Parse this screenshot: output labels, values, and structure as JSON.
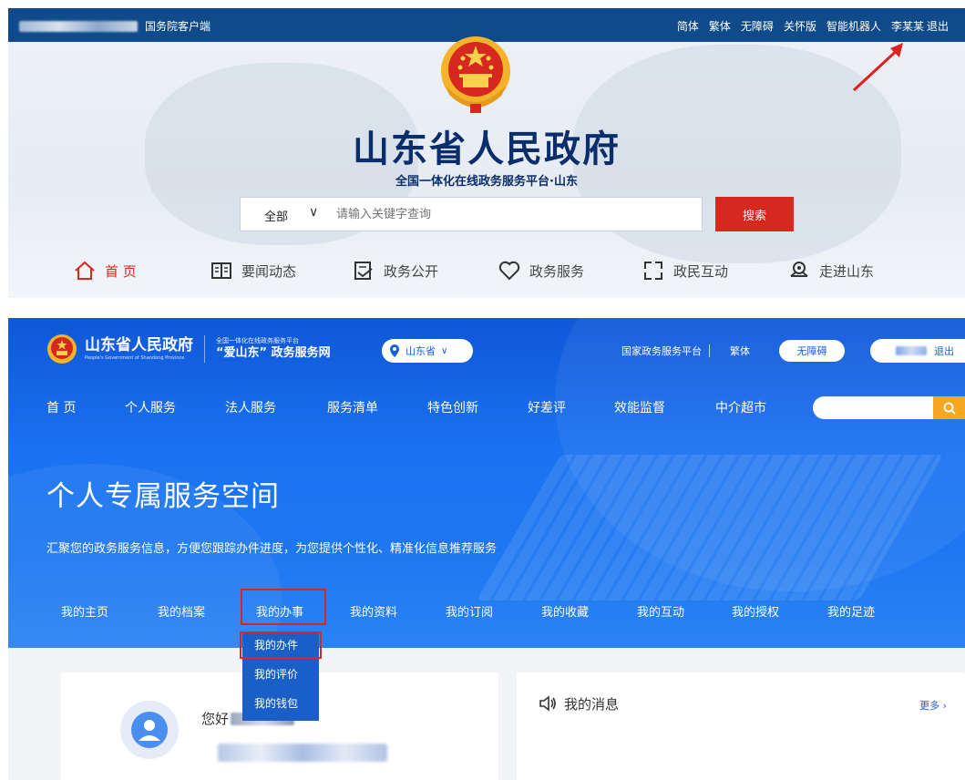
{
  "top": {
    "portal_name": "国务院客户端",
    "links": [
      "简体",
      "繁体",
      "无障碍",
      "关怀版",
      "智能机器人",
      "李某某",
      "退出"
    ],
    "title": "山东省人民政府",
    "subtitle": "全国一体化在线政务服务平台·山东",
    "search": {
      "scope": "全部",
      "placeholder": "请输入关键字查询",
      "button": "搜索"
    },
    "nav": [
      {
        "label": "首 页",
        "icon": "home-icon"
      },
      {
        "label": "要闻动态",
        "icon": "book-icon"
      },
      {
        "label": "政务公开",
        "icon": "inbox-icon"
      },
      {
        "label": "政务服务",
        "icon": "heart-icon"
      },
      {
        "label": "政民互动",
        "icon": "interaction-icon"
      },
      {
        "label": "走进山东",
        "icon": "map-pin-icon"
      }
    ]
  },
  "bottom": {
    "logo_title": "山东省人民政府",
    "logo_en": "People's Government of Shandong Province",
    "platform_small": "全国一体化在线政务服务平台",
    "platform_name": "“爱山东” 政务服务网",
    "region": "山东省",
    "header_links": {
      "national": "国家政务服务平台",
      "traditional": "繁体",
      "accessible": "无障碍",
      "logout": "退出"
    },
    "main_nav": [
      "首 页",
      "个人服务",
      "法人服务",
      "服务清单",
      "特色创新",
      "好差评",
      "效能监督",
      "中介超市"
    ],
    "space_title": "个人专属服务空间",
    "space_desc": "汇聚您的政务服务信息，方便您跟踪办件进度，为您提供个性化、精准化信息推荐服务",
    "sub_nav": [
      "我的主页",
      "我的档案",
      "我的办事",
      "我的资料",
      "我的订阅",
      "我的收藏",
      "我的互动",
      "我的授权",
      "我的足迹"
    ],
    "dropdown": [
      "我的办件",
      "我的评价",
      "我的钱包"
    ],
    "greeting": "您好",
    "messages_title": "我的消息",
    "more": "更多 ›"
  },
  "colors": {
    "top_bar": "#0f4a8a",
    "brand_red": "#d6281f",
    "hero_blue": "#1a72f0",
    "search_orange": "#f5a623"
  }
}
